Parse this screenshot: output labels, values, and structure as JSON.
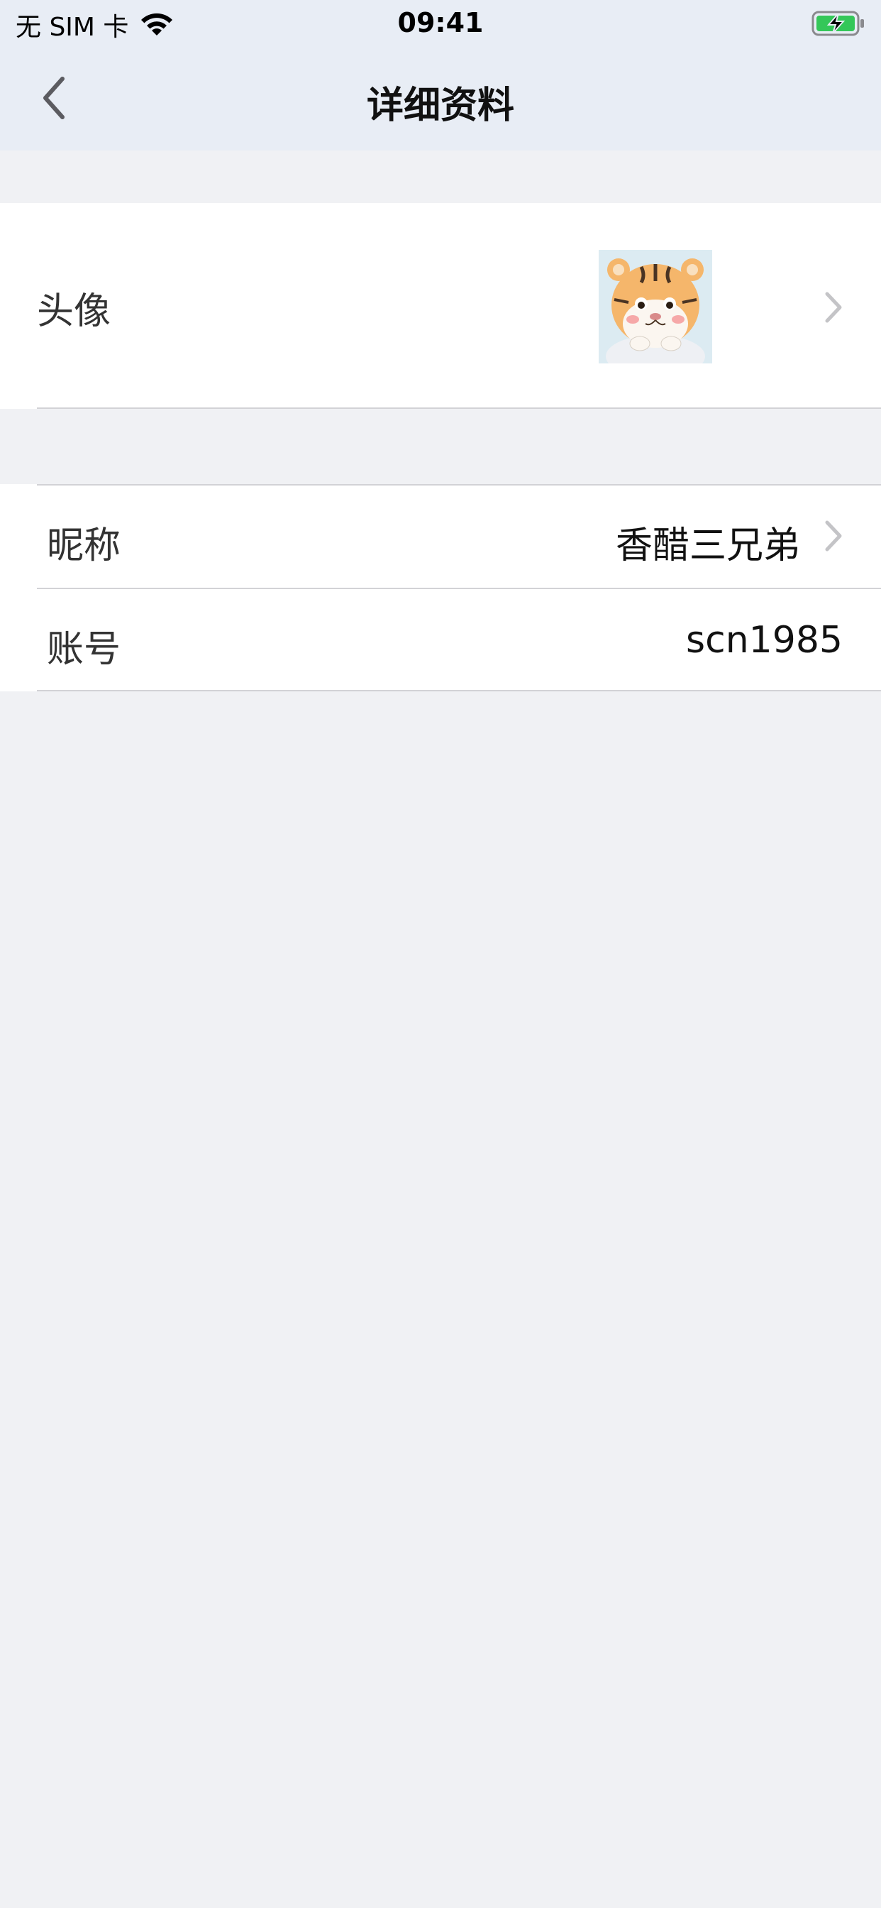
{
  "status_bar": {
    "carrier": "无 SIM 卡",
    "time": "09:41"
  },
  "nav": {
    "title": "详细资料"
  },
  "avatar_row": {
    "label": "头像"
  },
  "info_rows": {
    "nickname_label": "昵称",
    "nickname_value": "香醋三兄弟",
    "account_label": "账号",
    "account_value": "scn1985"
  },
  "colors": {
    "header_bg": "#e8edf5",
    "page_bg": "#f0f1f4",
    "battery_green": "#34c759"
  }
}
